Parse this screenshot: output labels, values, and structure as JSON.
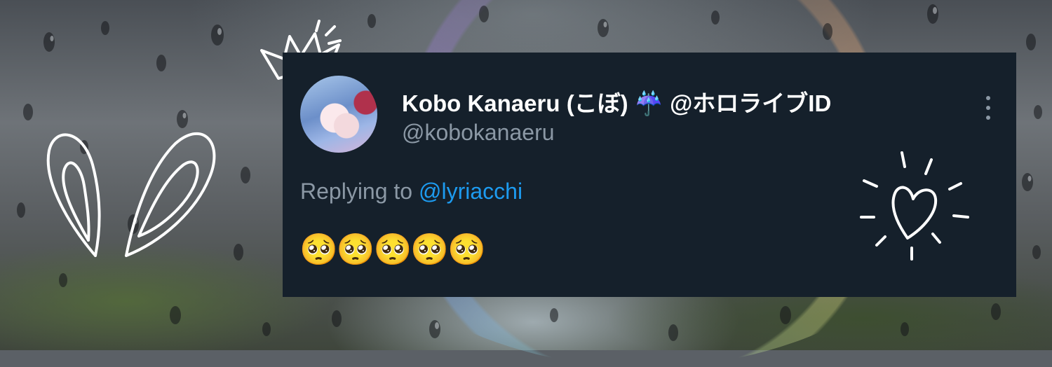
{
  "tweet": {
    "display_name": "Kobo Kanaeru (こぼ) ☔ @ホロライブID",
    "handle": "@kobokanaeru",
    "replying_prefix": "Replying to ",
    "replying_to": "@lyriacchi",
    "body": "🥺🥺🥺🥺🥺"
  },
  "icons": {
    "avatar": "avatar-image",
    "more": "more-options-icon",
    "doodles": [
      "crown-doodle-icon",
      "bunny-ears-doodle-icon",
      "sparkle-heart-doodle-icon"
    ]
  },
  "colors": {
    "card_background": "#15202b",
    "name_text": "#ffffff",
    "secondary_text": "#8b98a5",
    "link": "#1d9bf0"
  }
}
